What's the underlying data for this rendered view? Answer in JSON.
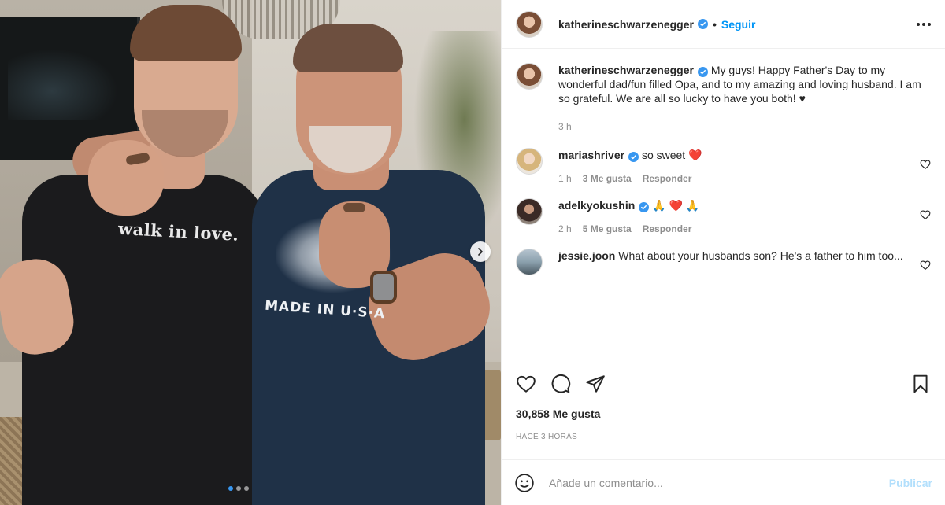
{
  "post": {
    "author": "katherineschwarzenegger",
    "follow_label": "Seguir",
    "separator": "•",
    "caption": "My guys! Happy Father's Day to my wonderful dad/fun filled Opa, and to my amazing and loving husband. I am so grateful. We are all so lucky to have you both! ♥",
    "caption_time": "3 h",
    "likes": "30,858 Me gusta",
    "posted_ago": "HACE 3 HORAS"
  },
  "photo": {
    "shirt_text_left": "walk in love.",
    "shirt_text_right": "MADE IN U·S·A",
    "carousel_dots": 3,
    "active_dot": 1
  },
  "comments": [
    {
      "user": "mariashriver",
      "verified": true,
      "text": "so sweet ❤️",
      "time": "1 h",
      "likes": "3 Me gusta",
      "reply": "Responder"
    },
    {
      "user": "adelkyokushin",
      "verified": true,
      "text": "🙏 ❤️ 🙏",
      "time": "2 h",
      "likes": "5 Me gusta",
      "reply": "Responder"
    },
    {
      "user": "jessie.joon",
      "verified": false,
      "text": "What about your husbands son? He's a father to him too..."
    }
  ],
  "composer": {
    "placeholder": "Añade un comentario...",
    "publish_label": "Publicar"
  },
  "colors": {
    "link_blue": "#0095f6",
    "verified_blue": "#3897f0",
    "muted": "#8e8e8e",
    "publish_disabled": "#b2dffc"
  }
}
